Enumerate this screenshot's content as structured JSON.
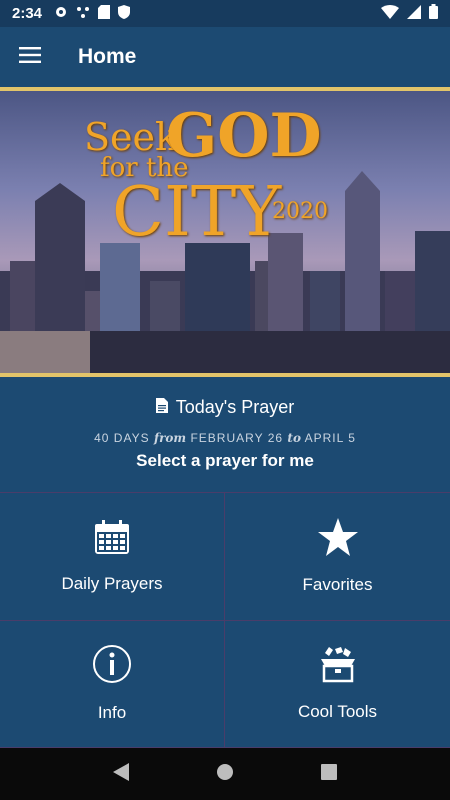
{
  "status_bar": {
    "time": "2:34",
    "left_icons": [
      "settings-icon",
      "hotspot-icon",
      "sd-card-icon",
      "shield-icon"
    ],
    "right_icons": [
      "wifi-icon",
      "signal-icon",
      "battery-icon"
    ]
  },
  "app_bar": {
    "title": "Home",
    "menu_icon": "menu-icon"
  },
  "banner": {
    "line1_a": "Seek",
    "line1_b": "GOD",
    "line2": "for the",
    "line3": "CITY",
    "year": "2020"
  },
  "prayer": {
    "title": "Today's Prayer",
    "icon": "document-icon",
    "sub_a": "40 DAYS",
    "sub_from": "from",
    "sub_b": "FEBRUARY 26",
    "sub_to": "to",
    "sub_c": "APRIL 5",
    "action": "Select a prayer for me"
  },
  "tiles": [
    {
      "label": "Daily Prayers",
      "icon": "calendar-icon"
    },
    {
      "label": "Favorites",
      "icon": "star-icon"
    },
    {
      "label": "Info",
      "icon": "info-icon"
    },
    {
      "label": "Cool Tools",
      "icon": "toolbox-icon"
    }
  ],
  "nav": {
    "icons": [
      "back-icon",
      "home-icon",
      "recents-icon"
    ]
  },
  "colors": {
    "primary": "#1c4a72",
    "accent_gold": "#e2c46a",
    "divider": "#4a3d6a"
  }
}
